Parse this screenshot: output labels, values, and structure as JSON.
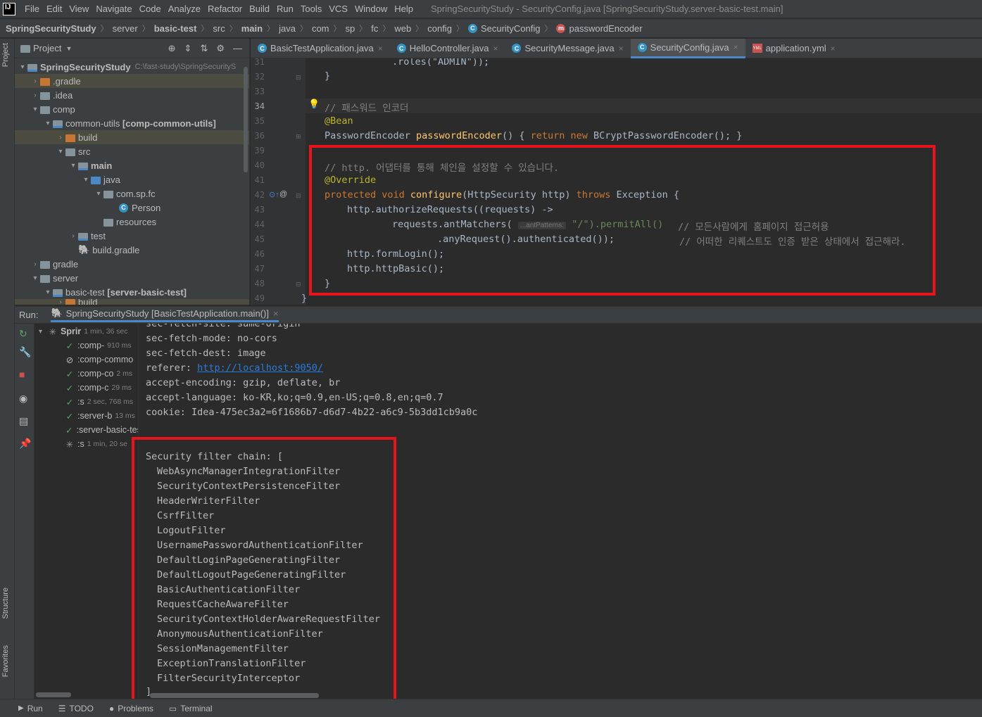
{
  "window_title": "SpringSecurityStudy - SecurityConfig.java [SpringSecurityStudy.server-basic-test.main]",
  "app_logo": "IJ",
  "menu": [
    "File",
    "Edit",
    "View",
    "Navigate",
    "Code",
    "Analyze",
    "Refactor",
    "Build",
    "Run",
    "Tools",
    "VCS",
    "Window",
    "Help"
  ],
  "breadcrumbs": [
    "SpringSecurityStudy",
    "server",
    "basic-test",
    "src",
    "main",
    "java",
    "com",
    "sp",
    "fc",
    "web",
    "config",
    "SecurityConfig",
    "passwordEncoder"
  ],
  "left_strip": {
    "project": "Project",
    "structure": "Structure",
    "favorites": "Favorites"
  },
  "project_panel": {
    "title": "Project",
    "tree": [
      {
        "label": "SpringSecurityStudy",
        "suffix": "C:\\fast-study\\SpringSecurityS"
      },
      {
        "label": ".gradle"
      },
      {
        "label": ".idea"
      },
      {
        "label": "comp"
      },
      {
        "label": "common-utils",
        "suffix": "[comp-common-utils]"
      },
      {
        "label": "build"
      },
      {
        "label": "src"
      },
      {
        "label": "main"
      },
      {
        "label": "java"
      },
      {
        "label": "com.sp.fc"
      },
      {
        "label": "Person"
      },
      {
        "label": "resources"
      },
      {
        "label": "test"
      },
      {
        "label": "build.gradle"
      },
      {
        "label": "gradle"
      },
      {
        "label": "server"
      },
      {
        "label": "basic-test",
        "suffix": "[server-basic-test]"
      },
      {
        "label": "build"
      }
    ]
  },
  "editor_tabs": [
    "BasicTestApplication.java",
    "HelloController.java",
    "SecurityMessage.java",
    "SecurityConfig.java",
    "application.yml"
  ],
  "editor": {
    "line_numbers": [
      "31",
      "32",
      "33",
      "34",
      "35",
      "36",
      "39",
      "40",
      "41",
      "42",
      "43",
      "44",
      "45",
      "46",
      "47",
      "48",
      "49"
    ],
    "lines": {
      "l31": ".roles(\"ADMIN\"));",
      "l32": "}",
      "l34": "// 패스워드 인코더",
      "l35": "@Bean",
      "l36a": "PasswordEncoder ",
      "l36b": "passwordEncoder",
      "l36c": "() { ",
      "l36d": "return new ",
      "l36e": "BCryptPasswordEncoder(); }",
      "l40": "// http. 어댑터를 통해 체인을 설정할 수 있습니다.",
      "l41": "@Override",
      "l42a": "protected void ",
      "l42b": "configure",
      "l42c": "(HttpSecurity http) ",
      "l42d": "throws ",
      "l42e": "Exception {",
      "l43": "http.authorizeRequests((requests) ->",
      "l44a": "requests.antMatchers( ",
      "l44hint": "...antPatterns:",
      "l44b": " \"/\").permitAll()",
      "l44c": "// 모든사람에게 홈페이지 접근허용",
      "l45a": ".anyRequest().authenticated());",
      "l45c": "// 어떠한 리퀘스트도 인증 받은 상태에서 접근해라.",
      "l46": "http.formLogin();",
      "l47": "http.httpBasic();",
      "l48": "}",
      "l49": "}"
    }
  },
  "run": {
    "label": "Run:",
    "tab": "SpringSecurityStudy [BasicTestApplication.main()]",
    "tree": [
      {
        "label": "Sprir",
        "time": "1 min, 36 sec",
        "status": "running"
      },
      {
        "label": ":comp-",
        "time": "910 ms",
        "status": "ok"
      },
      {
        "label": ":comp-commo",
        "time": "",
        "status": "skip"
      },
      {
        "label": ":comp-co",
        "time": "2 ms",
        "status": "ok"
      },
      {
        "label": ":comp-c",
        "time": "29 ms",
        "status": "ok"
      },
      {
        "label": ":s",
        "time": "2 sec, 768 ms",
        "status": "ok"
      },
      {
        "label": ":server-b",
        "time": "13 ms",
        "status": "ok"
      },
      {
        "label": ":server-basic-tes",
        "time": "",
        "status": "ok"
      },
      {
        "label": ":s",
        "time": "1 min, 20 se",
        "status": "running"
      }
    ],
    "console": {
      "partial_top": "sec-fetch-site: same-origin",
      "lines": [
        "sec-fetch-mode: no-cors",
        "sec-fetch-dest: image"
      ],
      "referer_label": "referer: ",
      "referer_link": "http://localhost:9050/",
      "lines2": [
        "accept-encoding: gzip, deflate, br",
        "accept-language: ko-KR,ko;q=0.9,en-US;q=0.8,en;q=0.7",
        "cookie: Idea-475ec3a2=6f1686b7-d6d7-4b22-a6c9-5b3dd1cb9a0c"
      ],
      "chain_title": "Security filter chain: [",
      "filters": [
        "WebAsyncManagerIntegrationFilter",
        "SecurityContextPersistenceFilter",
        "HeaderWriterFilter",
        "CsrfFilter",
        "LogoutFilter",
        "UsernamePasswordAuthenticationFilter",
        "DefaultLoginPageGeneratingFilter",
        "DefaultLogoutPageGeneratingFilter",
        "BasicAuthenticationFilter",
        "RequestCacheAwareFilter",
        "SecurityContextHolderAwareRequestFilter",
        "AnonymousAuthenticationFilter",
        "SessionManagementFilter",
        "ExceptionTranslationFilter",
        "FilterSecurityInterceptor"
      ],
      "chain_end": "]"
    }
  },
  "statusbar": [
    "Run",
    "TODO",
    "Problems",
    "Terminal"
  ],
  "colors": {
    "highlight_box": "#e8141c",
    "accent": "#4a88c7",
    "keyword": "#cc7832",
    "annotation": "#bbb529",
    "comment": "#808080"
  }
}
